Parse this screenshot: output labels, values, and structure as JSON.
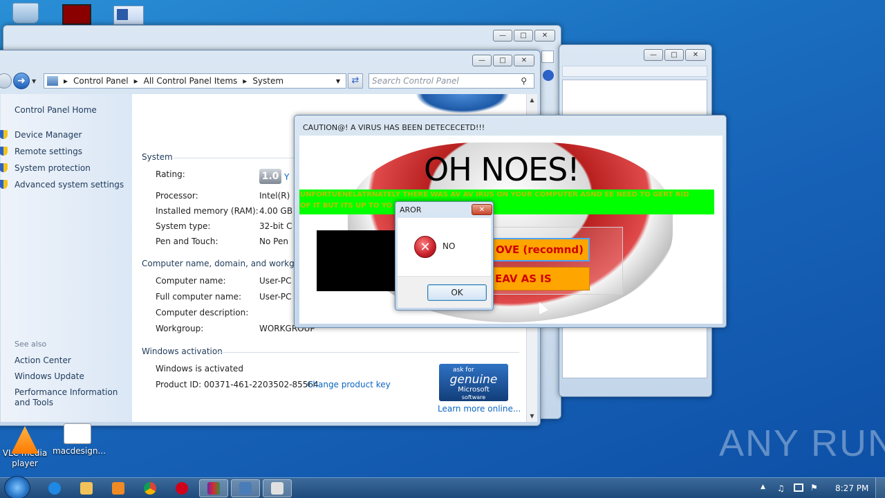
{
  "desktop": {
    "icons": [
      {
        "label": "VLC media player"
      },
      {
        "label": "macdesign..."
      }
    ],
    "watermark": "ANY RUN"
  },
  "system_window": {
    "breadcrumb": [
      "Control Panel",
      "All Control Panel Items",
      "System"
    ],
    "search_placeholder": "Search Control Panel",
    "left_links": {
      "home": "Control Panel Home",
      "device_manager": "Device Manager",
      "remote_settings": "Remote settings",
      "system_protection": "System protection",
      "advanced": "Advanced system settings"
    },
    "see_also": {
      "title": "See also",
      "items": [
        "Action Center",
        "Windows Update",
        "Performance Information and Tools"
      ]
    },
    "system": {
      "title": "System",
      "rating_label": "Rating:",
      "rating_value": "1.0",
      "rating_link": "Y",
      "processor_label": "Processor:",
      "processor_value": "Intel(R)",
      "memory_label": "Installed memory (RAM):",
      "memory_value": "4.00 GB",
      "type_label": "System type:",
      "type_value": "32-bit C",
      "pen_label": "Pen and Touch:",
      "pen_value": "No Pen"
    },
    "computer": {
      "title": "Computer name, domain, and workgro",
      "name_label": "Computer name:",
      "name_value": "User-PC",
      "full_label": "Full computer name:",
      "full_value": "User-PC",
      "desc_label": "Computer description:",
      "wg_label": "Workgroup:",
      "wg_value": "WORKGROUP"
    },
    "activation": {
      "title": "Windows activation",
      "status": "Windows is activated",
      "product_id": "Product ID: 00371-461-2203502-85564",
      "change_key": "Change product key",
      "genuine": {
        "ask": "ask for",
        "genuine": "genuine",
        "ms": "Microsoft",
        "sw": "software"
      },
      "learn_more": "Learn more online..."
    }
  },
  "virus_window": {
    "title": "CAUTION@! A VIRUS HAS BEEN DETECECETD!!!",
    "headline": "OH NOES!",
    "message_line1": "UNFORTUENELATRNATELY THERE WAS AV AV IRUS ON YOUR COMPUTER ASND EE NEED TO GERT RID",
    "message_line2": "OF IT BUT ITS UP TO YO",
    "remove_label": "OVE (recomnd)",
    "leave_label": "EAV AS IS"
  },
  "error_dialog": {
    "title": "AROR",
    "message": "NO",
    "ok": "OK"
  },
  "taskbar": {
    "time": "8:27 PM"
  },
  "colors": {
    "accent": "#1a6fc0",
    "green_banner": "#00ff00",
    "orange_button": "#ffa500",
    "error_red": "#c8202a"
  }
}
